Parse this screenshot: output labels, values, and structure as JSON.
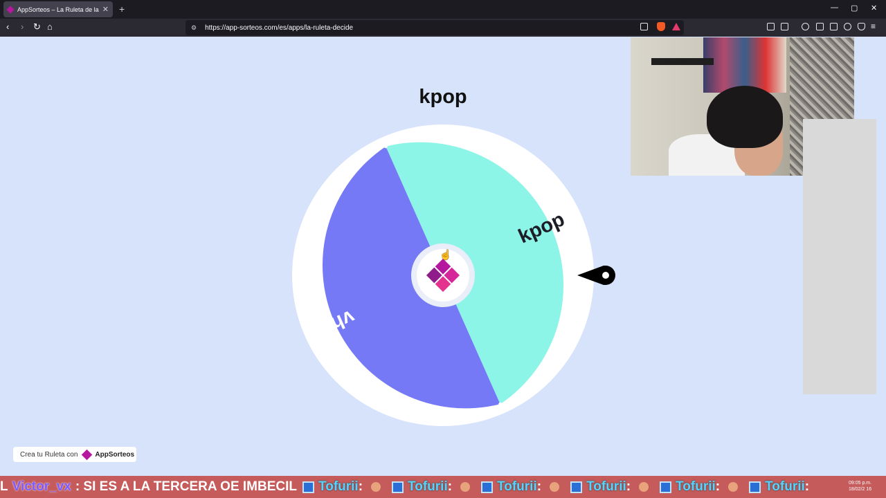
{
  "browser": {
    "tab_title": "AppSorteos – La Ruleta de la Su",
    "tab_close": "✕",
    "new_tab": "+",
    "url": "https://app-sorteos.com/es/apps/la-ruleta-decide",
    "window_controls": [
      "—",
      "▢",
      "✕"
    ]
  },
  "page": {
    "title": "kpop",
    "wheel": {
      "segments": [
        {
          "label": "kpop",
          "color": "#8cf5e8"
        },
        {
          "label": "vhs",
          "color": "#7579f5"
        }
      ],
      "border_color": "#ffffff",
      "center_logo_color": "#b5179e"
    },
    "promo": {
      "text": "Crea tu Ruleta con",
      "brand": "AppSorteos"
    }
  },
  "ticker": {
    "lead": "L",
    "user": "Victor_vx",
    "message": ": SI ES A LA TERCERA OE IMBECIL",
    "repeat_user": "Tofurii",
    "repeat_sep": ":",
    "clock_time": "09:05 p.m.",
    "clock_date": "18/02/2 16"
  }
}
